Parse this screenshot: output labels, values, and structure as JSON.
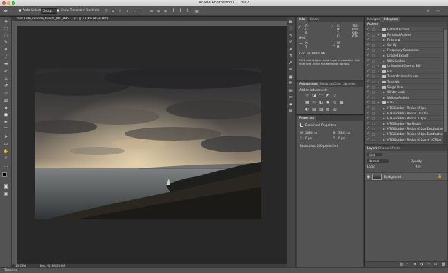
{
  "window": {
    "title": "Adobe Photoshop CC 2017"
  },
  "options_bar": {
    "auto_select_label": "Auto-Select:",
    "auto_select_value": "Group",
    "transform_label": "Show Transform Controls"
  },
  "document": {
    "tab_title": "20161106_random_howth_003_8957.CR2 @ 13.9% (RGB/16*)",
    "zoom": "13.93%",
    "doc_size": "Doc: 60.8M/60.8M"
  },
  "info_panel": {
    "tabs": [
      "Info",
      "History"
    ],
    "r_label": "R:",
    "g_label": "G:",
    "b_label": "B:",
    "bits": "8-bit",
    "c_label": "C:",
    "m_label": "M:",
    "y_label": "Y:",
    "k_label": "K:",
    "c_val": "71%",
    "m_val": "64%",
    "y_val": "64%",
    "k_val": "67%",
    "x_label": "X:",
    "y2_label": "Y:",
    "w_label": "W:",
    "h_label": "H:",
    "doc": "Doc: 60.8M/60.8M",
    "hint": "Click and drag to move layer or selection. Use Shift and Option for additional options."
  },
  "adjustments_panel": {
    "tabs": [
      "Adjustments",
      "Swatches",
      "Color",
      "Libraries"
    ],
    "heading": "Add an adjustment"
  },
  "properties_panel": {
    "tabs": [
      "Properties"
    ],
    "doc_props": "Document Properties",
    "w_label": "W:",
    "w_val": "5080 px",
    "h_label": "H:",
    "h_val": "3383 px",
    "x_label": "X:",
    "x_val": "0 px",
    "y_label": "Y:",
    "y_val": "0 px",
    "resolution": "Resolution: 240 pixels/inch"
  },
  "right_panel": {
    "tabs": [
      "Navigator",
      "Histogram"
    ],
    "actions_tab": "Actions",
    "actions": [
      {
        "label": "Default Actions",
        "type": "set",
        "open": false,
        "checked": true
      },
      {
        "label": "Personal Actions",
        "type": "set",
        "open": true,
        "checked": true
      },
      {
        "label": "Finishing",
        "type": "action",
        "checked": true
      },
      {
        "label": "Sel Up",
        "type": "action",
        "checked": true
      },
      {
        "label": "Frequency Separation",
        "type": "action",
        "checked": true
      },
      {
        "label": "Droplet Export",
        "type": "action",
        "checked": true
      },
      {
        "label": "50% Guides",
        "type": "action",
        "checked": true
      },
      {
        "label": "Unleashed Cinema Still",
        "type": "set",
        "open": false,
        "checked": true
      },
      {
        "label": "BTs",
        "type": "set",
        "open": false,
        "checked": true
      },
      {
        "label": "Tuber Actions Course",
        "type": "set",
        "open": false,
        "checked": true
      },
      {
        "label": "Tutorials",
        "type": "set",
        "open": false,
        "checked": true
      },
      {
        "label": "Single Use",
        "type": "set",
        "open": false,
        "checked": true
      },
      {
        "label": "Winter Look",
        "type": "action",
        "checked": true
      },
      {
        "label": "Writing Actions",
        "type": "action",
        "checked": true
      },
      {
        "label": "HTG",
        "type": "set",
        "open": true,
        "checked": true
      },
      {
        "label": "HTG Border - Resize 650px",
        "type": "action",
        "checked": true
      },
      {
        "label": "HTG Border - Resize 1070px",
        "type": "action",
        "checked": true
      },
      {
        "label": "HTG Border - Resize 376px",
        "type": "action",
        "checked": true
      },
      {
        "label": "HTG Border - No Resize",
        "type": "action",
        "checked": true
      },
      {
        "label": "HTG Border - Resize 650px Destructive",
        "type": "action",
        "checked": true
      },
      {
        "label": "HTG Border - Resize 650px Destructive",
        "type": "action",
        "checked": true
      },
      {
        "label": "HTG Border - Resize 650px + 1070px",
        "type": "action",
        "checked": true
      }
    ]
  },
  "layers_panel": {
    "tabs": [
      "Layers",
      "Channels",
      "Paths"
    ],
    "kind": "Kind",
    "blend": "Normal",
    "opacity_label": "Opacity:",
    "lock_label": "Lock:",
    "fill_label": "Fill:",
    "layer_name": "Background"
  },
  "timeline": {
    "label": "Timeline"
  },
  "colors": {
    "accent": "#4a90d9",
    "panel": "#535353",
    "bg": "#262626"
  }
}
